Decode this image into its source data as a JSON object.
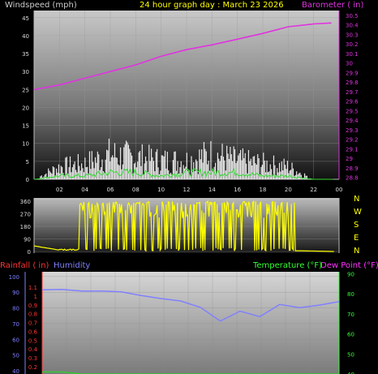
{
  "chart_data": [
    {
      "type": "line",
      "title": "24 hour graph day : March 23 2026",
      "left_label": "Windspeed (mph)",
      "right_label": "Barometer ( in)",
      "x_ticks": [
        "02",
        "04",
        "06",
        "08",
        "10",
        "12",
        "14",
        "16",
        "18",
        "20",
        "22",
        "00"
      ],
      "y_left_ticks": [
        0,
        5,
        10,
        15,
        20,
        25,
        30,
        35,
        40,
        45
      ],
      "y_left_range": [
        0,
        47
      ],
      "y_right_ticks": [
        "28.8",
        "28.9",
        "29",
        "29.1",
        "29.2",
        "29.3",
        "29.4",
        "29.5",
        "29.6",
        "29.7",
        "29.8",
        "29.9",
        "30",
        "30.1",
        "30.2",
        "30.3",
        "30.4",
        "30.5"
      ],
      "y_right_range": [
        28.78,
        30.55
      ],
      "hours": [
        0,
        2,
        4,
        6,
        8,
        10,
        12,
        14,
        16,
        18,
        20,
        22,
        23.4
      ],
      "series": [
        {
          "name": "Barometer ( in)",
          "color": "#e033e0",
          "values": [
            29.72,
            29.77,
            29.84,
            29.91,
            29.98,
            30.07,
            30.14,
            30.19,
            30.25,
            30.31,
            30.38,
            30.41,
            30.42
          ]
        },
        {
          "name": "",
          "color": "#e8e8e8",
          "values": [
            0,
            4,
            5,
            8,
            7,
            6,
            6,
            8,
            6,
            5,
            4,
            0,
            0
          ]
        },
        {
          "name": "",
          "color": "#33dd33",
          "values": [
            0,
            1,
            1,
            2,
            2,
            1,
            2,
            2,
            2,
            1,
            1,
            0,
            0
          ]
        }
      ]
    },
    {
      "type": "line",
      "y_ticks": [
        0,
        90,
        180,
        270,
        360
      ],
      "y_range": [
        0,
        360
      ],
      "right_labels": [
        "N",
        "W",
        "S",
        "E",
        "N"
      ],
      "series": [
        {
          "name": "",
          "color": "#ffff00",
          "values": [
            40,
            40,
            20,
            5,
            8,
            6,
            350,
            5,
            180,
            340,
            280,
            350,
            10,
            5,
            30,
            340,
            300,
            20,
            300,
            5,
            0
          ]
        }
      ]
    },
    {
      "type": "line",
      "labels": {
        "rainfall": "Rainfall ( in)",
        "humidity": "Humidity",
        "temperature": "Temperature (°F)",
        "dew_point": "Dew Point (°F)"
      },
      "humidity_ticks": [
        40,
        50,
        60,
        70,
        80,
        90,
        100
      ],
      "rain_ticks": [
        "0.2",
        "0.3",
        "0.4",
        "0.5",
        "0.6",
        "0.7",
        "0.8",
        "0.9",
        "1",
        "1.1"
      ],
      "temp_ticks": [
        40,
        50,
        60,
        70,
        80,
        90
      ],
      "humidity_range": [
        38,
        103
      ],
      "temp_range": [
        40,
        91
      ],
      "series": [
        {
          "name": "Humidity",
          "color": "#8080ff",
          "values": [
            92,
            92,
            91,
            91,
            90,
            88,
            86,
            84,
            80,
            72,
            78,
            74,
            82,
            80,
            82,
            84
          ]
        },
        {
          "name": "",
          "color": "#33cc33",
          "values": [
            41,
            41,
            40,
            40,
            40,
            40,
            40,
            40,
            40,
            40,
            40,
            40,
            40,
            40,
            40,
            40
          ]
        }
      ]
    }
  ],
  "colors": {
    "wind_label": "#cccccc",
    "title": "#ffff00",
    "baro": "#e033e0",
    "rain": "#ff3333",
    "humidity": "#8080ff",
    "temp": "#33ff33",
    "dew": "#ff33ff",
    "dir": "#ffff00",
    "axis_text": "#dddddd"
  }
}
